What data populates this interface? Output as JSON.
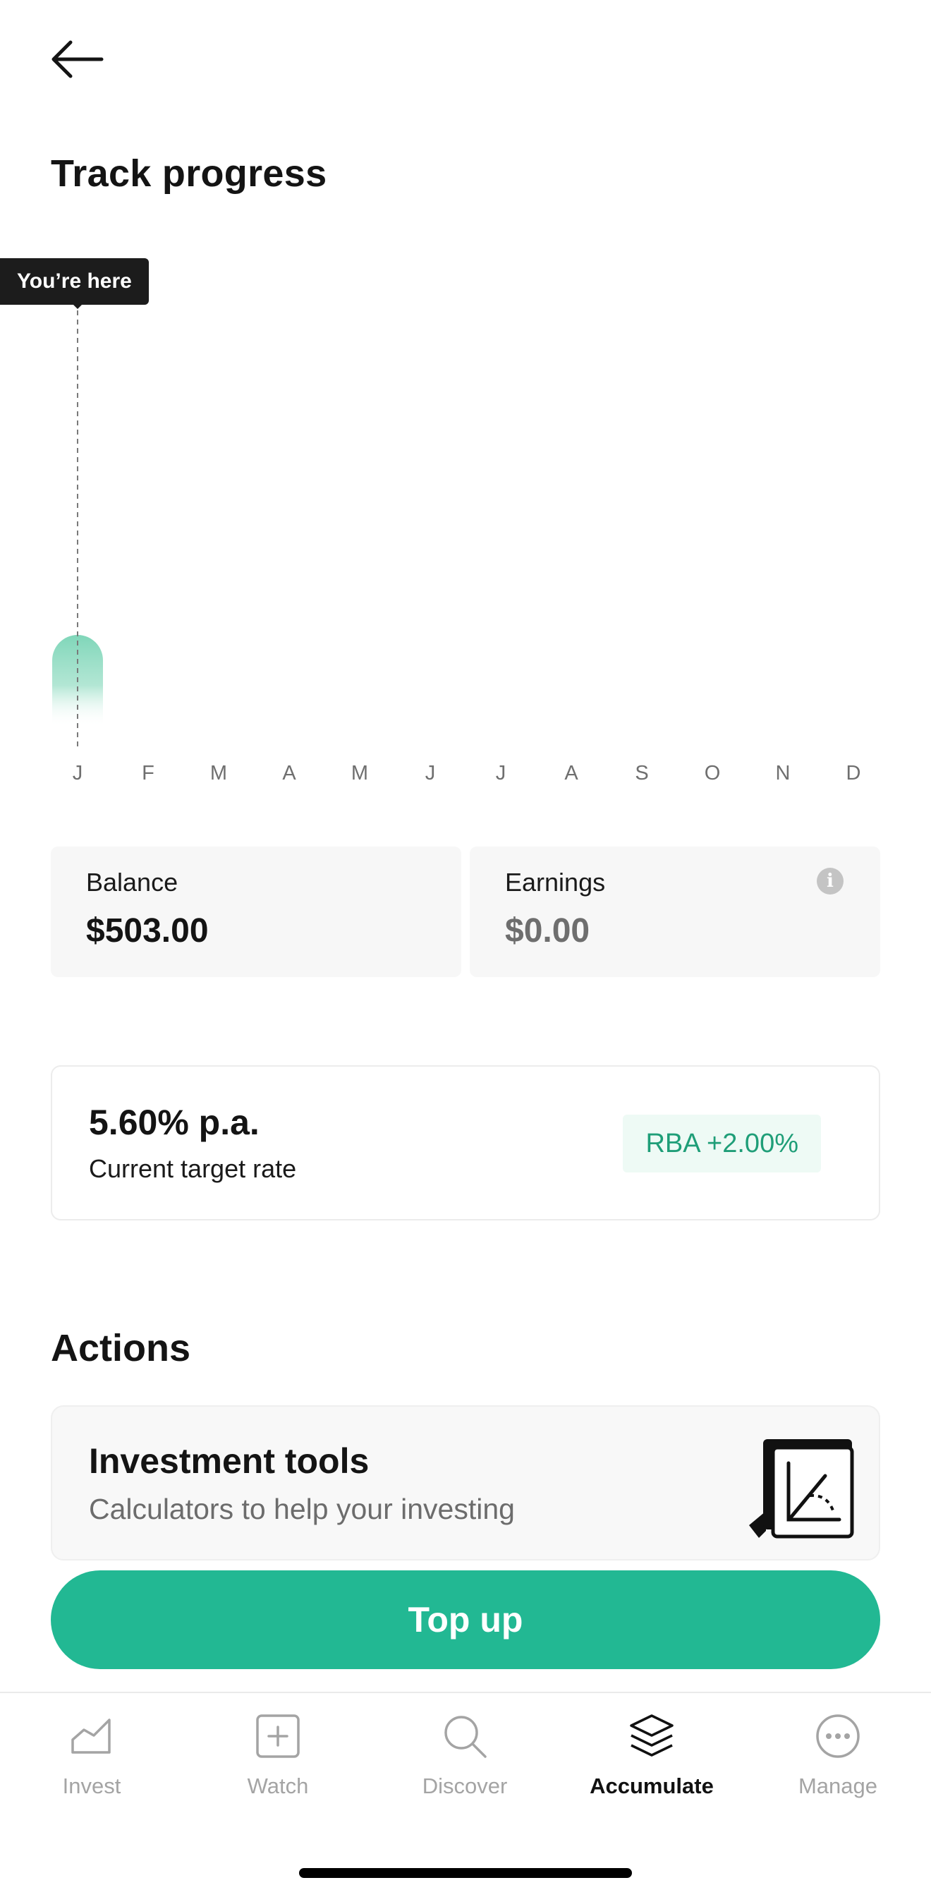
{
  "page": {
    "title": "Track progress",
    "back_icon": "arrow-left-icon"
  },
  "chart_data": {
    "type": "bar",
    "categories": [
      "J",
      "F",
      "M",
      "A",
      "M",
      "J",
      "J",
      "A",
      "S",
      "O",
      "N",
      "D"
    ],
    "series": [
      {
        "values": [
          503,
          null,
          null,
          null,
          null,
          null,
          null,
          null,
          null,
          null,
          null,
          null
        ]
      }
    ],
    "marker": {
      "label": "You’re here",
      "category_index": 0
    },
    "bar_color": "#7fd6b9"
  },
  "stats": {
    "balance": {
      "label": "Balance",
      "value": "$503.00"
    },
    "earnings": {
      "label": "Earnings",
      "value": "$0.00",
      "info_icon": "info-icon"
    }
  },
  "rate": {
    "value": "5.60% p.a.",
    "label": "Current target rate",
    "badge": "RBA +2.00%"
  },
  "actions": {
    "title": "Actions",
    "tools": {
      "title": "Investment tools",
      "subtitle": "Calculators to help your investing"
    }
  },
  "top_up": {
    "label": "Top up",
    "color": "#22b893"
  },
  "tabs": [
    {
      "label": "Invest",
      "icon": "chart-icon",
      "active": false
    },
    {
      "label": "Watch",
      "icon": "plus-square-icon",
      "active": false
    },
    {
      "label": "Discover",
      "icon": "search-icon",
      "active": false
    },
    {
      "label": "Accumulate",
      "icon": "layers-icon",
      "active": true
    },
    {
      "label": "Manage",
      "icon": "more-icon",
      "active": false
    }
  ]
}
